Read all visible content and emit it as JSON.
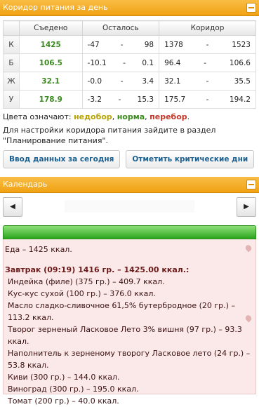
{
  "corridor": {
    "title": "Коридор питания за день",
    "headers": [
      "",
      "Съедено",
      "Осталось",
      "Коридор"
    ],
    "rows": [
      {
        "label": "К",
        "eaten": "1425",
        "left_min": "-47",
        "left_max": "98",
        "corr_min": "1378",
        "corr_max": "1523"
      },
      {
        "label": "Б",
        "eaten": "106.5",
        "left_min": "-10.1",
        "left_max": "0.1",
        "corr_min": "96.4",
        "corr_max": "106.6"
      },
      {
        "label": "Ж",
        "eaten": "32.1",
        "left_min": "-0.0",
        "left_max": "3.4",
        "corr_min": "32.1",
        "corr_max": "35.5"
      },
      {
        "label": "У",
        "eaten": "178.9",
        "left_min": "-3.2",
        "left_max": "15.3",
        "corr_min": "175.7",
        "corr_max": "194.2"
      }
    ],
    "legend_prefix": "Цвета означают: ",
    "legend_under": "недобор",
    "legend_norm": "норма",
    "legend_over": "перебор",
    "note": "Для настройки коридора питания зайдите в раздел \"Планирование питания\".",
    "btn_enter_today": "Ввод данных за сегодня",
    "btn_mark_critical": "Отметить критические дни"
  },
  "calendar": {
    "title": "Календарь",
    "prev_icon": "◀",
    "next_icon": "▶",
    "total_line": "Еда – 1425 ккал.",
    "meal_title": "Завтрак (09:19) 1416 гр. – 1425.00 ккал.:",
    "items": [
      "Индейка (филе) (375 гр.) – 409.7 ккал.",
      "Кус-кус сухой (100 гр.) – 376.0 ккал.",
      "Масло сладко-сливочное 61,5% бутербродное (20 гр.) – 113.2 ккал.",
      "Творог зерненый Ласковое Лето 3% вишня (97 гр.) – 93.3 ккал.",
      "Наполнитель к зерненому творогу Ласковое лето (24 гр.) – 53.8 ккал.",
      "Киви (300 гр.) – 144.0 ккал.",
      "Виноград (300 гр.) – 195.0 ккал.",
      "Томат (200 гр.) – 40.0 ккал."
    ]
  },
  "colors": {
    "accent": "#f0a213",
    "eaten_green": "#3a8a1e",
    "day_bg": "#fbe9e9"
  }
}
